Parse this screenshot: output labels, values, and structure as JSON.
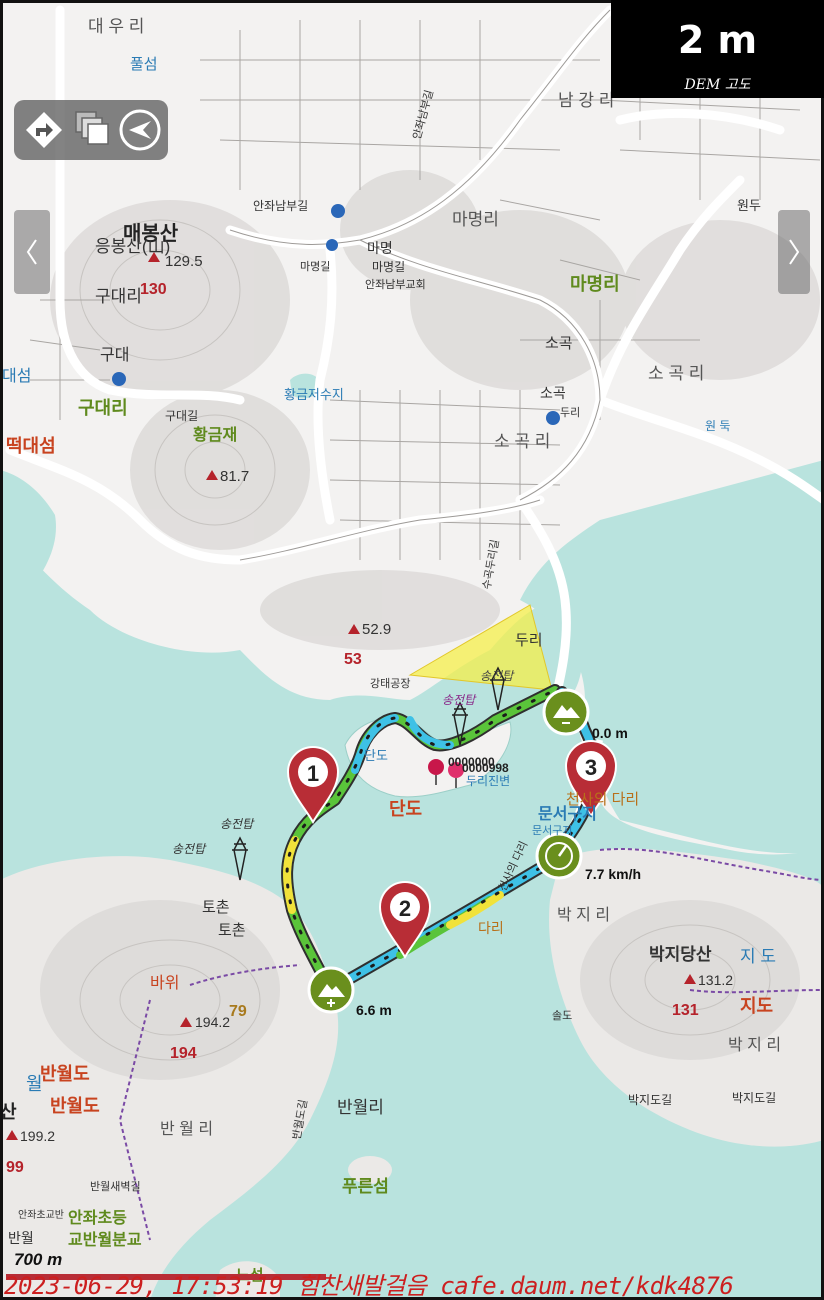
{
  "hud": {
    "elevation_value": "2 m",
    "elevation_label": "DEM 고도"
  },
  "place_labels": {
    "daeuri": "대 우 리",
    "pulseom": "풀섬",
    "namgangri": "남 강 리",
    "maebongsan": "매봉산",
    "eungbongsan": "응봉산(山)",
    "peak_129": "129.5",
    "peak_130": "130",
    "gudaeri1": "구대리",
    "gudae": "구대",
    "gudaeri_green": "구대리",
    "gudae_gil": "구대길",
    "daeseom_left": "대섬",
    "tteokdaeseom": "떡대섬",
    "hwanggeumjae": "황금재",
    "peak_81": "81.7",
    "hwanggeum_reservoir": "황금저수지",
    "anjwa_nambu_gil": "안좌남부길",
    "mamyeong": "마명",
    "mamyeongri": "마명리",
    "mamyeongri_green": "마명리",
    "mamyeong_gil": "마명길",
    "anjwa_nambu_church": "안좌남부교회",
    "sogok": "소곡",
    "sogok2": "소곡",
    "sogokri": "소 곡 리",
    "sogokri2": "소 곡 리",
    "duri_gil": "두리",
    "wondu": "원두",
    "wondeok": "원 둑",
    "sugokduri_gil": "수곡두리길",
    "peak_52": "52.9",
    "peak_53": "53",
    "duri": "두리",
    "pylon_1": "송전탑",
    "pylon_2": "송전탑",
    "pylon_3": "송전탑",
    "pylon_4": "송전탑",
    "gangtae_factory": "강태공장",
    "dando_small": "단도",
    "dando": "단도",
    "duri_jinbyeon": "두리진변",
    "marker_code": "0000000",
    "marker_code2": "0000998",
    "cheonsa_bridge": "천사의 다리",
    "munseo_guji": "문서구지",
    "munseo_guji2": "문서구지",
    "cheonsa_bridge_lower": "다리",
    "tochon": "토촌",
    "tochon2": "토촌",
    "bakjiri": "박 지 리",
    "bakjiri2": "박 지 리",
    "bakjidangsan": "박지당산",
    "jido": "지 도",
    "jido2": "지도",
    "peak_131_2": "131.2",
    "peak_131": "131",
    "bakji_gil": "박지도길",
    "bakji_gil2": "박지도길",
    "bawi": "바위",
    "peak_79": "79",
    "peak_194_2": "194.2",
    "peak_194": "194",
    "banwoldo": "반월도",
    "banwoldo2": "반월도",
    "wol": "월",
    "sanl": "산",
    "banwolri": "반월리",
    "banwolri2": "반 월 리",
    "banwol_gil": "반월도길",
    "peak_199": "199.2",
    "peak_99": "99",
    "pureunseom": "푸른섬",
    "banwol_saebyeol_gil": "반월새벽길",
    "anjwa_elem": "안좌초등",
    "banwol_branch": "교반월분교",
    "anjwa_school_small": "안좌초교반",
    "banwol_small": "반월",
    "noseom": "노섬",
    "cheonsa_road": "천사의 다리",
    "anjwa_nambu_gil2": "안좌남부길",
    "mamyeong_gil2": "마명길",
    "sotdo": "솔도"
  },
  "track": {
    "start_distance": "0.0 m",
    "end_distance": "6.6 m",
    "speed": "7.7 km/h",
    "waypoints": [
      "1",
      "2",
      "3"
    ]
  },
  "scale": {
    "label": "700 m"
  },
  "watermark": {
    "text": "2023-06-29, 17:53:19 힘찬새발걸음 cafe.daum.net/kdk4876"
  },
  "colors": {
    "water": "#b9e3de",
    "land": "#f3f2f1",
    "road": "#ffffff",
    "track_green": "#5ac43a",
    "track_cyan": "#3ec1e6",
    "track_yellow": "#f1e23a",
    "marker_red": "#b82d36",
    "start_green": "#6a8f1d",
    "peak_red": "#b5232b",
    "label_green": "#5f8a1d",
    "label_blue": "#2a7bb4",
    "label_orange": "#c8431f",
    "watermark_red": "#cc1f1f"
  },
  "icons": {
    "route": "diamond-arrow-icon",
    "layers": "layers-icon",
    "compass": "compass-icon",
    "start": "mountain-plus-icon",
    "finish": "mountain-minus-icon",
    "speed": "speedometer-icon"
  }
}
